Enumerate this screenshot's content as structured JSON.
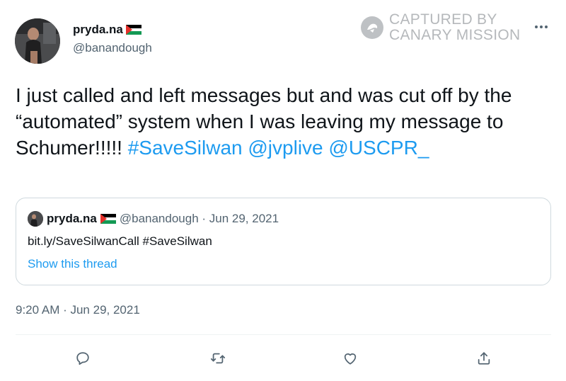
{
  "author": {
    "display_name": "pryda.na",
    "handle": "@banandough",
    "avatar": "avatar",
    "flag_icon": "palestine-flag-icon"
  },
  "watermark": {
    "line1": "CAPTURED BY",
    "line2": "CANARY MISSION",
    "logo": "canary-mission-logo"
  },
  "menu_icon": "more-icon",
  "tweet": {
    "text_part1": "I just called and left messages but and was cut off by the “automated” system when I was leaving my message to Schumer!!!!! ",
    "hashtag": "#SaveSilwan",
    "mention1": "@jvplive",
    "mention2": "@USCPR_"
  },
  "quoted_tweet": {
    "display_name": "pryda.na",
    "meta": "@banandough · Jun 29, 2021",
    "link_text": "bit.ly/SaveSilwanCall #SaveSilwan",
    "show_thread": "Show this thread"
  },
  "timestamp": "9:20 AM · Jun 29, 2021",
  "actions": {
    "reply": "reply-icon",
    "retweet": "retweet-icon",
    "like": "like-icon",
    "share": "share-icon"
  },
  "colors": {
    "link": "#1d9bf0",
    "muted": "#536471",
    "text": "#0f1419",
    "border": "#cfd9de"
  }
}
